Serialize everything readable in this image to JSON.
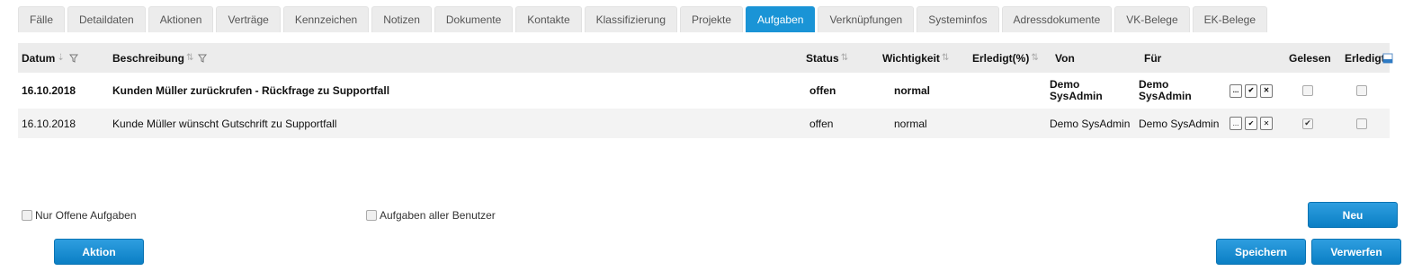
{
  "tabs": [
    {
      "label": "Fälle"
    },
    {
      "label": "Detaildaten"
    },
    {
      "label": "Aktionen"
    },
    {
      "label": "Verträge"
    },
    {
      "label": "Kennzeichen"
    },
    {
      "label": "Notizen"
    },
    {
      "label": "Dokumente"
    },
    {
      "label": "Kontakte"
    },
    {
      "label": "Klassifizierung"
    },
    {
      "label": "Projekte"
    },
    {
      "label": "Aufgaben",
      "active": true
    },
    {
      "label": "Verknüpfungen"
    },
    {
      "label": "Systeminfos"
    },
    {
      "label": "Adressdokumente"
    },
    {
      "label": "VK-Belege"
    },
    {
      "label": "EK-Belege"
    }
  ],
  "table": {
    "headers": {
      "datum": "Datum",
      "beschreibung": "Beschreibung",
      "status": "Status",
      "wichtigkeit": "Wichtigkeit",
      "erledigt_pct": "Erledigt(%)",
      "von": "Von",
      "fuer": "Für",
      "gelesen": "Gelesen",
      "erledigt": "Erledigt"
    },
    "rows": [
      {
        "datum": "16.10.2018",
        "beschreibung": "Kunden Müller zurückrufen - Rückfrage zu Supportfall",
        "status": "offen",
        "wichtigkeit": "normal",
        "erledigt_pct": "",
        "von": "Demo SysAdmin",
        "fuer": "Demo SysAdmin",
        "gelesen": false,
        "erledigt": false,
        "unread": true
      },
      {
        "datum": "16.10.2018",
        "beschreibung": "Kunde Müller wünscht Gutschrift zu Supportfall",
        "status": "offen",
        "wichtigkeit": "normal",
        "erledigt_pct": "",
        "von": "Demo SysAdmin",
        "fuer": "Demo SysAdmin",
        "gelesen": true,
        "erledigt": false,
        "unread": false
      }
    ],
    "row_buttons": {
      "more": "...",
      "confirm": "✔",
      "reject": "✕"
    }
  },
  "filters": {
    "nur_offene": {
      "label": "Nur Offene Aufgaben",
      "checked": false
    },
    "alle_benutzer": {
      "label": "Aufgaben aller Benutzer",
      "checked": false
    }
  },
  "buttons": {
    "neu": "Neu",
    "aktion": "Aktion",
    "speichern": "Speichern",
    "verwerfen": "Verwerfen"
  },
  "colors": {
    "accent": "#1a94d6",
    "header_bg": "#ececec"
  }
}
